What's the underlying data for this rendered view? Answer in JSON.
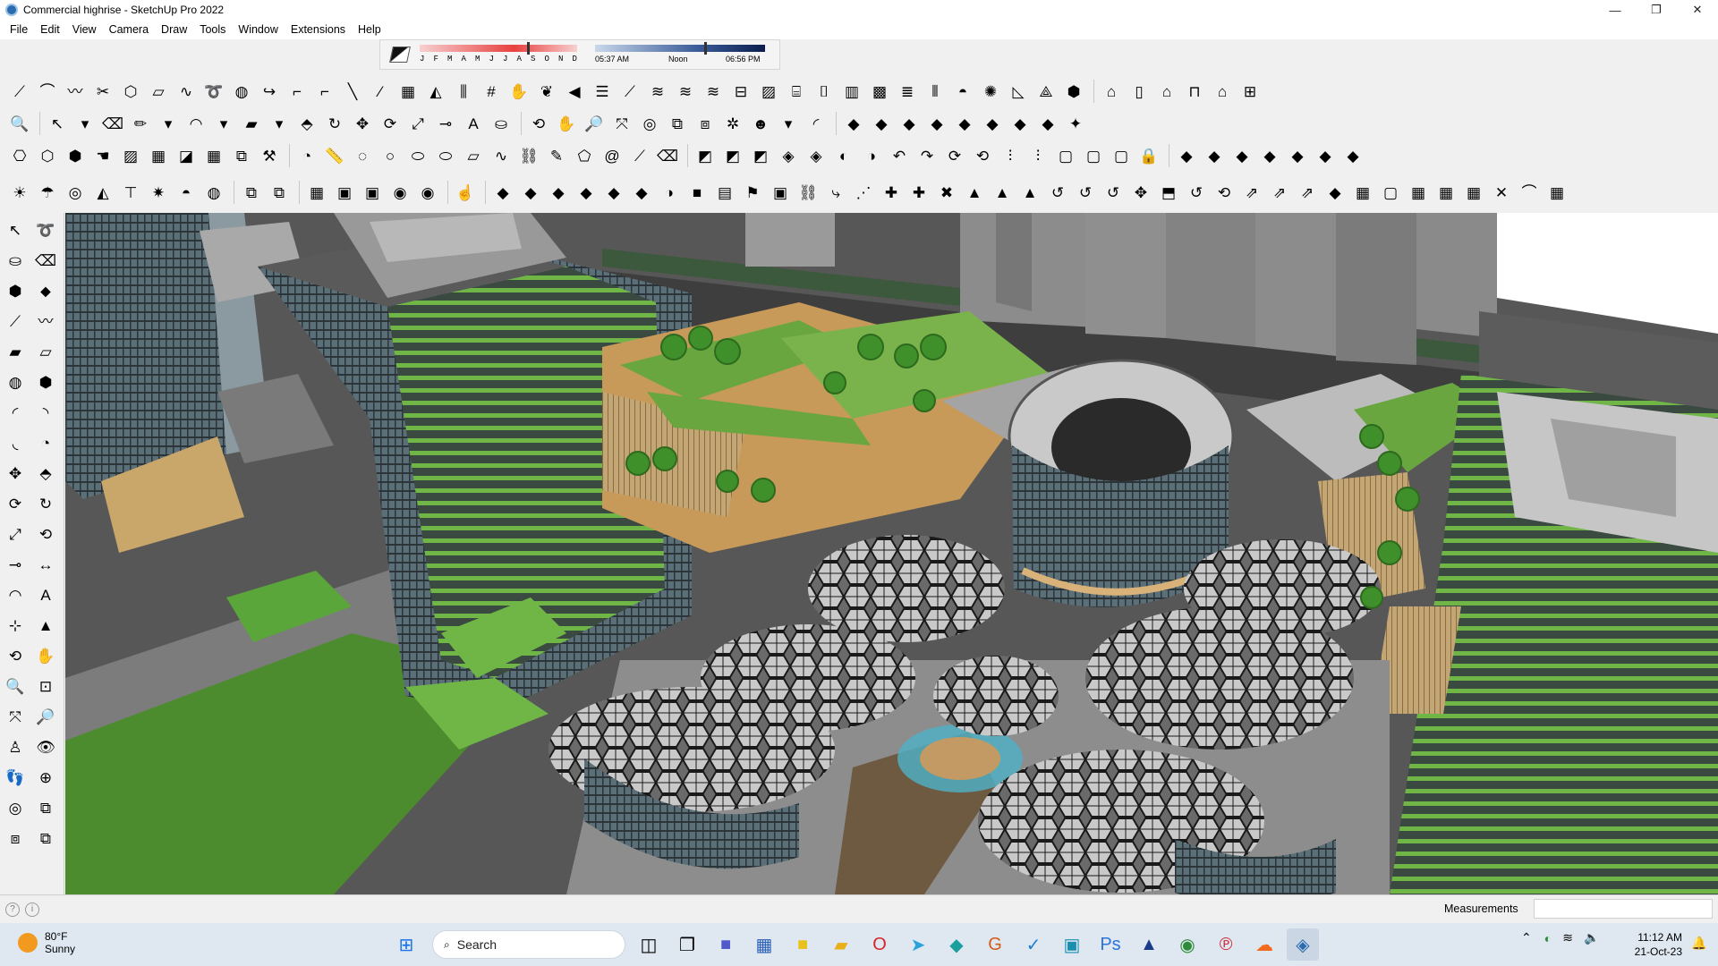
{
  "window": {
    "title": "Commercial highrise - SketchUp Pro 2022",
    "controls": [
      "—",
      "❐",
      "✕"
    ]
  },
  "menu": [
    "File",
    "Edit",
    "View",
    "Camera",
    "Draw",
    "Tools",
    "Window",
    "Extensions",
    "Help"
  ],
  "shadows": {
    "months": [
      "J",
      "F",
      "M",
      "A",
      "M",
      "J",
      "J",
      "A",
      "S",
      "O",
      "N",
      "D"
    ],
    "sunrise": "05:37 AM",
    "noon": "Noon",
    "sunset": "06:56 PM"
  },
  "status": {
    "measurements_label": "Measurements",
    "measurements_value": ""
  },
  "taskbar": {
    "weather": {
      "temp": "80°F",
      "condition": "Sunny"
    },
    "search_label": "Search",
    "time": "11:12 AM",
    "date": "21-Oct-23"
  }
}
